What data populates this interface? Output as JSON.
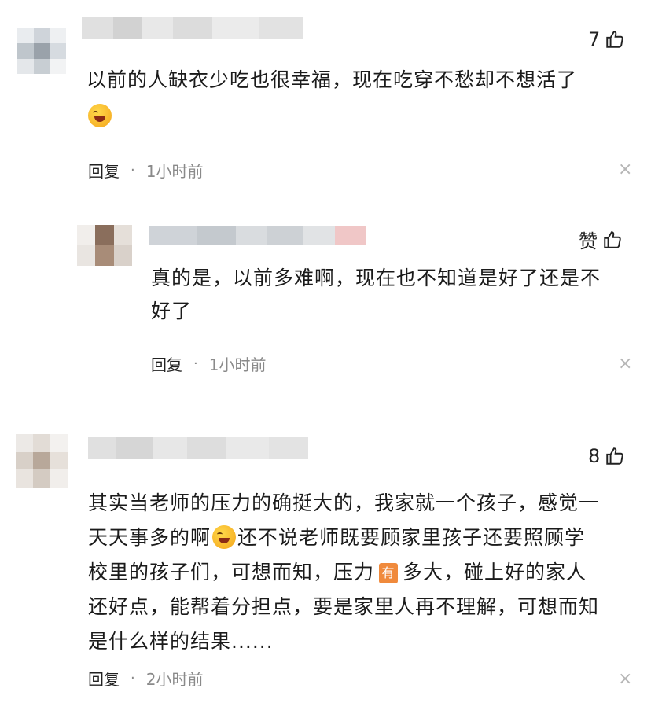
{
  "comments": [
    {
      "likes": "7",
      "text": "以前的人缺衣少吃也很幸福，现在吃穿不愁却不想活了",
      "reply_label": "回复",
      "dot": "·",
      "time": "1小时前",
      "close": "×",
      "reply": {
        "likes": "赞",
        "text_line1": "真的是，以前多难啊，现在也不知道是好了还是不",
        "text_line2": "好了",
        "reply_label": "回复",
        "dot": "·",
        "time": "1小时前",
        "close": "×"
      }
    },
    {
      "likes": "8",
      "lines": [
        "其实当老师的压力的确挺大的，我家就一个孩子，感觉一",
        "天天事多的啊",
        "还不说老师既要顾家里孩子还要照顾学",
        "校里的孩子们，可想而知，压力",
        "有",
        "多大，碰上好的家人",
        "还好点，能帮着分担点，要是家里人再不理解，可想而知",
        "是什么样的结果......"
      ],
      "reply_label": "回复",
      "dot": "·",
      "time": "2小时前",
      "close": "×"
    }
  ]
}
